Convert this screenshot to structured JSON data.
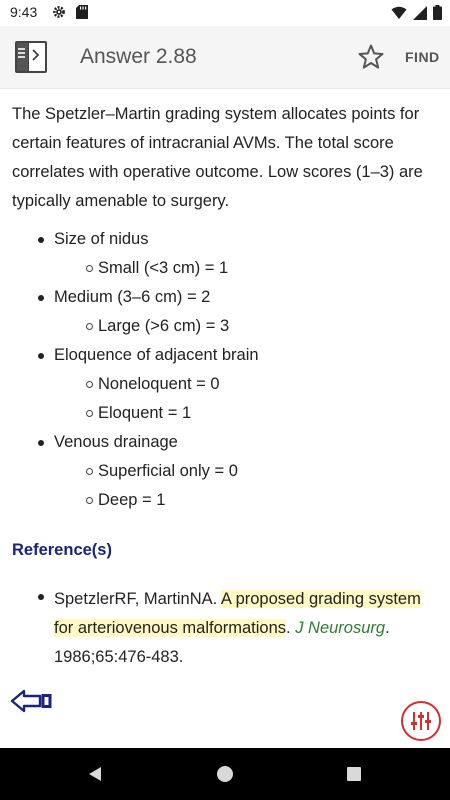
{
  "status_bar": {
    "time": "9:43",
    "icons": [
      "gear-icon",
      "sd-card-icon",
      "wifi-icon",
      "signal-icon",
      "battery-icon"
    ]
  },
  "app_bar": {
    "title": "Answer 2.88",
    "find_label": "FIND",
    "icons": [
      "book-icon",
      "star-icon"
    ]
  },
  "content": {
    "intro": "The Spetzler–Martin grading system allocates points for certain features of intracranial AVMs. The total score correlates with operative outcome. Low scores (1–3) are typically amenable to surgery.",
    "bullets": [
      {
        "level": 1,
        "text": "Size of nidus"
      },
      {
        "level": 2,
        "text": "Small (<3 cm) = 1"
      },
      {
        "level": 1,
        "text": "Medium (3–6 cm) = 2"
      },
      {
        "level": 2,
        "text": "Large (>6 cm) = 3"
      },
      {
        "level": 1,
        "text": "Eloquence of adjacent brain"
      },
      {
        "level": 2,
        "text": "Noneloquent = 0"
      },
      {
        "level": 2,
        "text": "Eloquent = 1"
      },
      {
        "level": 1,
        "text": "Venous drainage"
      },
      {
        "level": 2,
        "text": "Superficial only = 0"
      },
      {
        "level": 2,
        "text": "Deep = 1"
      }
    ],
    "reference_heading": "Reference(s)",
    "reference": {
      "authors": "SpetzlerRF, MartinNA. ",
      "title": "A proposed grading system for arteriovenous malformations",
      "after_title": ". ",
      "journal": "J Neurosurg",
      "citation": ". 1986;65:476-483."
    }
  },
  "colors": {
    "reference_heading": "#1a237e",
    "highlight": "#fff9c4",
    "journal": "#2e7d32",
    "filter_accent": "#d32f2f",
    "back_arrow": "#1a237e"
  },
  "nav_bar": {
    "icons": [
      "nav-back-icon",
      "nav-home-icon",
      "nav-recents-icon"
    ]
  }
}
